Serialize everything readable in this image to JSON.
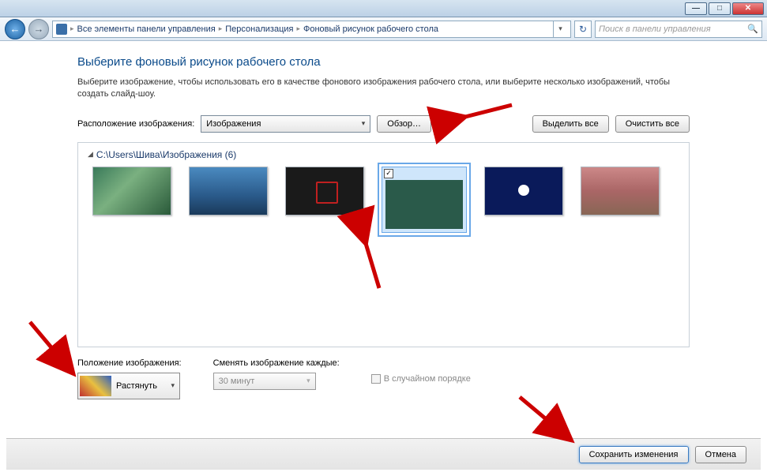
{
  "breadcrumbs": {
    "root": "Все элементы панели управления",
    "mid": "Персонализация",
    "leaf": "Фоновый рисунок рабочего стола"
  },
  "search": {
    "placeholder": "Поиск в панели управления"
  },
  "page": {
    "title": "Выберите фоновый рисунок рабочего стола",
    "description": "Выберите изображение, чтобы использовать его в качестве фонового изображения рабочего стола, или выберите несколько изображений, чтобы создать слайд-шоу."
  },
  "location": {
    "label": "Расположение изображения:",
    "value": "Изображения",
    "browse": "Обзор…",
    "select_all": "Выделить все",
    "clear_all": "Очистить все"
  },
  "group": {
    "header": "C:\\Users\\Шива\\Изображения (6)"
  },
  "position": {
    "label": "Положение изображения:",
    "value": "Растянуть"
  },
  "interval": {
    "label": "Сменять изображение каждые:",
    "value": "30 минут"
  },
  "shuffle": {
    "label": "В случайном порядке"
  },
  "footer": {
    "save": "Сохранить изменения",
    "cancel": "Отмена"
  }
}
